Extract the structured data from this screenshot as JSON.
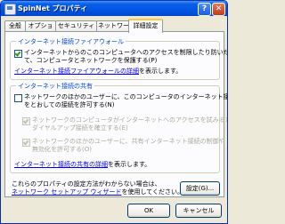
{
  "window": {
    "title": "SpinNet プロパティ",
    "help": "?",
    "close": "✕"
  },
  "tabs": [
    "全般",
    "オプション",
    "セキュリティ",
    "ネットワーク",
    "詳細設定"
  ],
  "firewall": {
    "legend": "インターネット接続ファイアウォール",
    "checkbox_line1": "インターネットからのこのコンピュータへのアクセスを制限したり防いだりし",
    "checkbox_line2": "て、コンピュータとネットワークを保護する(P)",
    "link": "インターネット接続ファイアウォールの詳細",
    "link_suffix": "を表示します。"
  },
  "sharing": {
    "legend": "インターネット接続の共有",
    "cb1_line1": "ネットワークのほかのユーザーに、このコンピュータのインターネット接続",
    "cb1_line2": "をとおしての接続を許可する(N)",
    "cb2_line1": "ネットワークのコンピュータがインターネットへのアクセスを試みるたびに",
    "cb2_line2": "ダイヤルアップ接続を確立する(E)",
    "cb3_line1": "ネットワークのほかのユーザーに、共有インターネット接続の制御や",
    "cb3_line2": "無効化を許可する(O)",
    "link": "インターネット接続の共有の詳細",
    "link_suffix": "を表示します。"
  },
  "footer": {
    "line1": "これらのプロパティの設定方法がわからない場合は、",
    "link": "ネットワーク セットアップ ウィザード",
    "link_suffix": "を使用してください。",
    "settings_button": "設定(G)...",
    "ok_button": "OK",
    "cancel_button": "キャンセル"
  },
  "state": {
    "firewall_enabled": true,
    "share_enabled": false,
    "dialup_enabled": true,
    "allow_control": true
  }
}
